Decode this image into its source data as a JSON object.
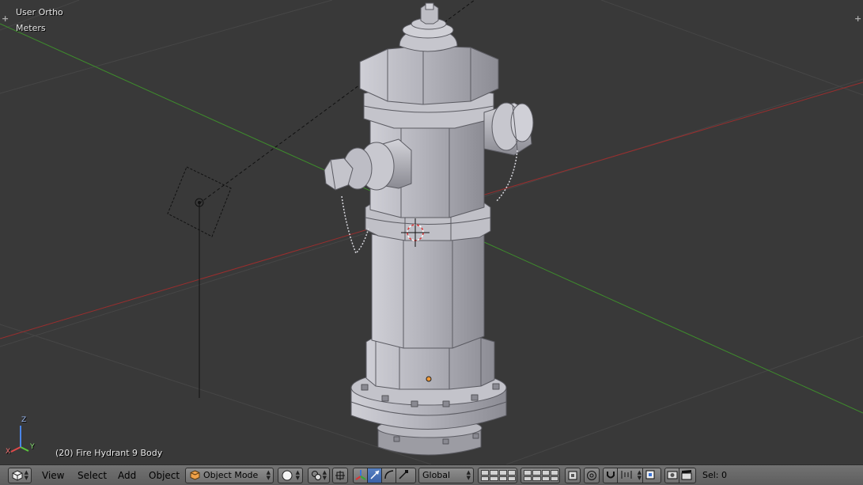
{
  "viewport": {
    "view_name": "User Ortho",
    "units": "Meters",
    "object_info": "(20) Fire Hydrant 9 Body",
    "axis_x": "X",
    "axis_y": "Y",
    "axis_z": "Z"
  },
  "header": {
    "editor_type_icon": "3d-view-cube-icon",
    "menus": [
      "View",
      "Select",
      "Add",
      "Object"
    ],
    "mode": "Object Mode",
    "viewport_shading_icon": "sphere-solid-icon",
    "pivot_icon": "pivot-point-icon",
    "transform_orientation": "Global",
    "selection_count": "Sel: 0"
  },
  "colors": {
    "background": "#393939",
    "grid": "#4a4a4a",
    "x_axis": "#9a2e2e",
    "y_axis": "#3e8d2c",
    "hydrant": "#aeaeb6",
    "header": "#6a6a6a",
    "active_button": "#4a72b8"
  }
}
